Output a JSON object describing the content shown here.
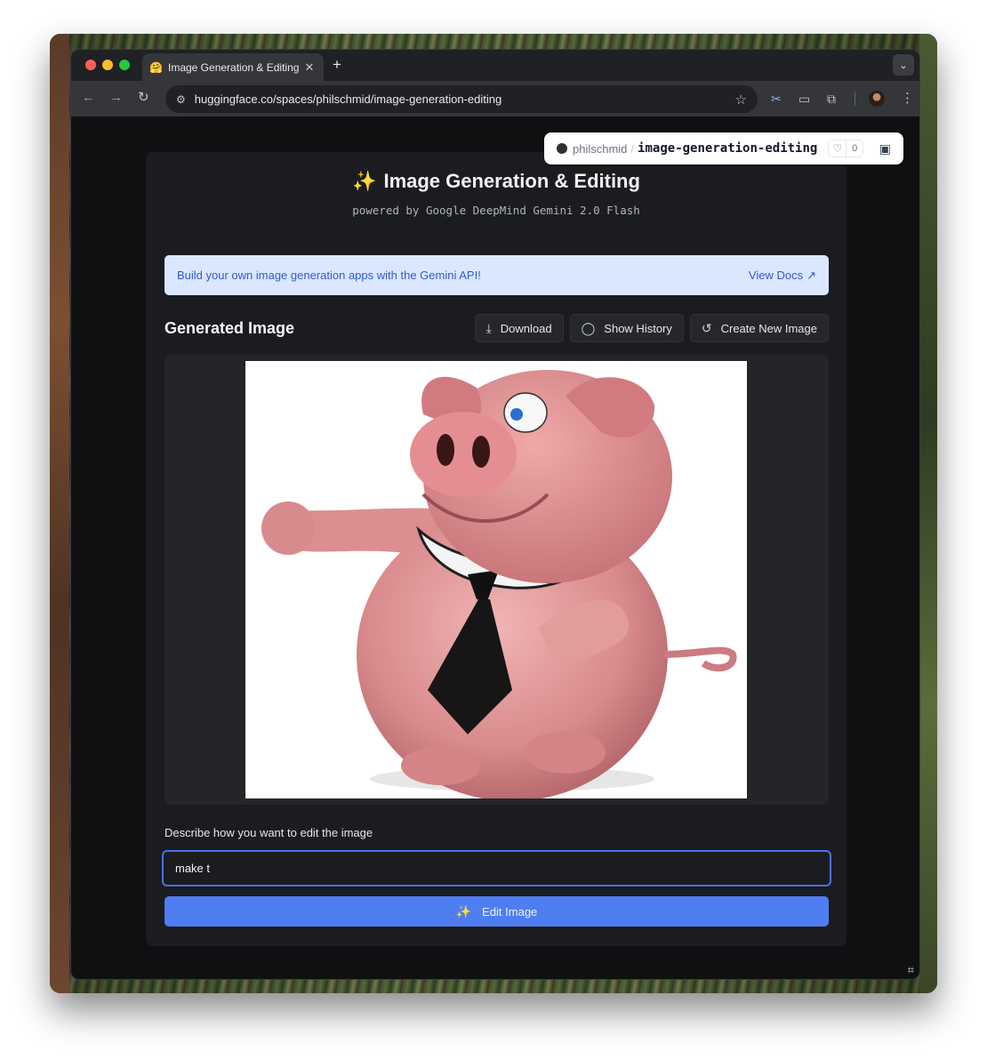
{
  "browser": {
    "tab": {
      "title": "Image Generation & Editing -",
      "favicon": "hugging-face-emoji",
      "close": "✕"
    },
    "new_tab": "+",
    "tab_menu": "⌄",
    "url": "huggingface.co/spaces/philschmid/image-generation-editing"
  },
  "space_badge": {
    "owner": "philschmid",
    "slash": "/",
    "repo": "image-generation-editing",
    "likes": "0"
  },
  "app": {
    "title": "Image Generation & Editing",
    "subtitle": "powered by Google DeepMind Gemini 2.0 Flash",
    "banner_text": "Build your own image generation apps with the Gemini API!",
    "banner_link": "View Docs",
    "section_title": "Generated Image",
    "actions": {
      "download": "Download",
      "history": "Show History",
      "new_image": "Create New Image"
    },
    "image_subject": "3D cartoon pig wearing a white collar and black tie",
    "prompt_label": "Describe how you want to edit the image",
    "prompt_value": "make t",
    "edit_button": "Edit Image"
  },
  "colors": {
    "accent": "#4f7ef3",
    "banner_bg": "#dbe7ff",
    "page_bg": "#101012",
    "card_bg": "#1b1c1f"
  }
}
